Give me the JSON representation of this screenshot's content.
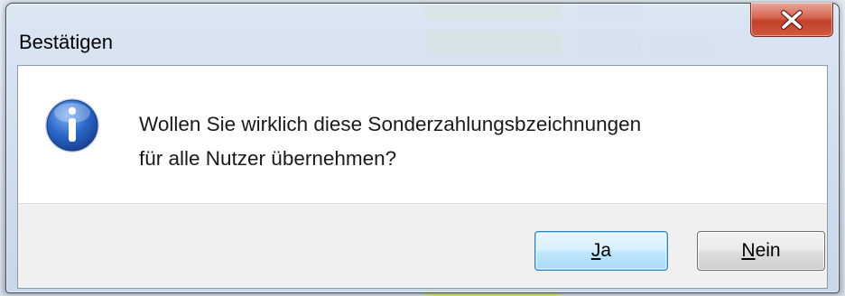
{
  "dialog": {
    "title": "Bestätigen",
    "close_label": "X",
    "icon": "information-icon",
    "message_lines": [
      "Wollen Sie wirklich diese Sonderzahlungsbzeichnungen",
      "für alle Nutzer übernehmen?"
    ],
    "buttons": {
      "yes": {
        "accel": "J",
        "rest": "a"
      },
      "no": {
        "accel": "N",
        "rest": "ein"
      }
    }
  },
  "colors": {
    "close_button": "#c7442e",
    "info_icon": "#2a66c9",
    "default_button_border": "#3c7fb1"
  }
}
